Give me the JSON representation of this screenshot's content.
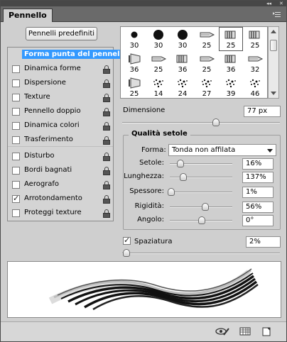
{
  "window": {
    "tab_title": "Pennello",
    "collapse_glyph": "◂◂",
    "close_glyph": "✕"
  },
  "presets_button": "Pennelli predefiniti",
  "options": [
    {
      "label": "Forma punta del pennello",
      "has_checkbox": false,
      "checked": false,
      "selected": true,
      "locked": false
    },
    {
      "label": "Dinamica forme",
      "has_checkbox": true,
      "checked": false,
      "selected": false,
      "locked": true
    },
    {
      "label": "Dispersione",
      "has_checkbox": true,
      "checked": false,
      "selected": false,
      "locked": true
    },
    {
      "label": "Texture",
      "has_checkbox": true,
      "checked": false,
      "selected": false,
      "locked": true
    },
    {
      "label": "Pennello doppio",
      "has_checkbox": true,
      "checked": false,
      "selected": false,
      "locked": true
    },
    {
      "label": "Dinamica colori",
      "has_checkbox": true,
      "checked": false,
      "selected": false,
      "locked": true
    },
    {
      "label": "Trasferimento",
      "has_checkbox": true,
      "checked": false,
      "selected": false,
      "locked": true
    },
    {
      "label": "Disturbo",
      "has_checkbox": true,
      "checked": false,
      "selected": false,
      "locked": true
    },
    {
      "label": "Bordi bagnati",
      "has_checkbox": true,
      "checked": false,
      "selected": false,
      "locked": true
    },
    {
      "label": "Aerografo",
      "has_checkbox": true,
      "checked": false,
      "selected": false,
      "locked": true
    },
    {
      "label": "Arrotondamento",
      "has_checkbox": true,
      "checked": true,
      "selected": false,
      "locked": true
    },
    {
      "label": "Proteggi texture",
      "has_checkbox": true,
      "checked": false,
      "selected": false,
      "locked": true
    }
  ],
  "brush_tips": [
    {
      "size": "30",
      "kind": "hard-round-small"
    },
    {
      "size": "30",
      "kind": "hard-round"
    },
    {
      "size": "30",
      "kind": "hard-round"
    },
    {
      "size": "25",
      "kind": "bristle-side"
    },
    {
      "size": "25",
      "kind": "bristle-flat",
      "selected": true
    },
    {
      "size": "25",
      "kind": "bristle-flat"
    },
    {
      "size": "36",
      "kind": "bristle-fan"
    },
    {
      "size": "25",
      "kind": "bristle-side"
    },
    {
      "size": "36",
      "kind": "bristle-flat"
    },
    {
      "size": "25",
      "kind": "bristle-side"
    },
    {
      "size": "36",
      "kind": "bristle-flat"
    },
    {
      "size": "32",
      "kind": "bristle-side"
    },
    {
      "size": "25",
      "kind": "bristle-fan"
    },
    {
      "size": "14",
      "kind": "scatter"
    },
    {
      "size": "24",
      "kind": "scatter"
    },
    {
      "size": "27",
      "kind": "scatter"
    },
    {
      "size": "39",
      "kind": "scatter"
    },
    {
      "size": "46",
      "kind": "scatter"
    }
  ],
  "dimension": {
    "label": "Dimensione",
    "value": "77 px",
    "level": 0.6
  },
  "bristle": {
    "title": "Qualità setole",
    "shape_label": "Forma:",
    "shape_value": "Tonda non affilata",
    "rows": [
      {
        "label": "Setole:",
        "value": "16%",
        "level": 0.16
      },
      {
        "label": "Lunghezza:",
        "value": "137%",
        "level": 0.2
      },
      {
        "label": "Spessore:",
        "value": "1%",
        "level": 0.01
      },
      {
        "label": "Rigidità:",
        "value": "56%",
        "level": 0.56
      },
      {
        "label": "Angolo:",
        "value": "0°",
        "level": 0.5
      }
    ]
  },
  "spacing": {
    "label": "Spaziatura",
    "checked": true,
    "value": "2%",
    "level": 0.02
  },
  "icons": {
    "lock": "lock-icon",
    "bristle_preview": "bristle-preview-icon",
    "grid": "grid-icon",
    "new_preset": "new-preset-icon"
  }
}
